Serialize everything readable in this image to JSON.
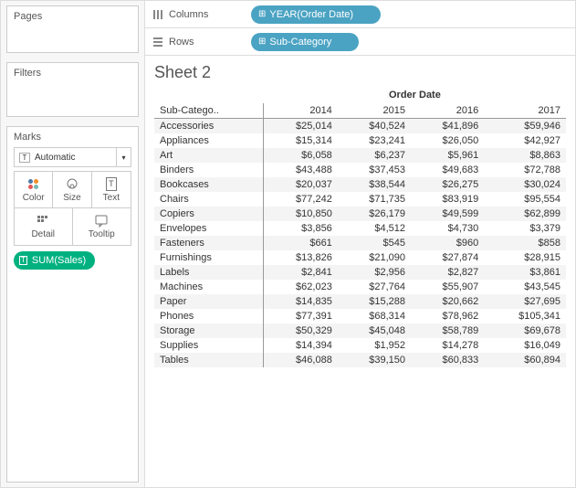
{
  "sidebar": {
    "pages_title": "Pages",
    "filters_title": "Filters",
    "marks_title": "Marks",
    "marks_dropdown": "Automatic",
    "mark_buttons": {
      "color": "Color",
      "size": "Size",
      "text": "Text",
      "detail": "Detail",
      "tooltip": "Tooltip"
    },
    "measure_pill": "SUM(Sales)"
  },
  "shelves": {
    "columns_label": "Columns",
    "columns_pill": "YEAR(Order Date)",
    "rows_label": "Rows",
    "rows_pill": "Sub-Category"
  },
  "sheet": {
    "title": "Sheet 2",
    "super_header": "Order Date",
    "row_header": "Sub-Catego..",
    "columns": [
      "2014",
      "2015",
      "2016",
      "2017"
    ],
    "rows": [
      "Accessories",
      "Appliances",
      "Art",
      "Binders",
      "Bookcases",
      "Chairs",
      "Copiers",
      "Envelopes",
      "Fasteners",
      "Furnishings",
      "Labels",
      "Machines",
      "Paper",
      "Phones",
      "Storage",
      "Supplies",
      "Tables"
    ],
    "values": [
      [
        "$25,014",
        "$40,524",
        "$41,896",
        "$59,946"
      ],
      [
        "$15,314",
        "$23,241",
        "$26,050",
        "$42,927"
      ],
      [
        "$6,058",
        "$6,237",
        "$5,961",
        "$8,863"
      ],
      [
        "$43,488",
        "$37,453",
        "$49,683",
        "$72,788"
      ],
      [
        "$20,037",
        "$38,544",
        "$26,275",
        "$30,024"
      ],
      [
        "$77,242",
        "$71,735",
        "$83,919",
        "$95,554"
      ],
      [
        "$10,850",
        "$26,179",
        "$49,599",
        "$62,899"
      ],
      [
        "$3,856",
        "$4,512",
        "$4,730",
        "$3,379"
      ],
      [
        "$661",
        "$545",
        "$960",
        "$858"
      ],
      [
        "$13,826",
        "$21,090",
        "$27,874",
        "$28,915"
      ],
      [
        "$2,841",
        "$2,956",
        "$2,827",
        "$3,861"
      ],
      [
        "$62,023",
        "$27,764",
        "$55,907",
        "$43,545"
      ],
      [
        "$14,835",
        "$15,288",
        "$20,662",
        "$27,695"
      ],
      [
        "$77,391",
        "$68,314",
        "$78,962",
        "$105,341"
      ],
      [
        "$50,329",
        "$45,048",
        "$58,789",
        "$69,678"
      ],
      [
        "$14,394",
        "$1,952",
        "$14,278",
        "$16,049"
      ],
      [
        "$46,088",
        "$39,150",
        "$60,833",
        "$60,894"
      ]
    ]
  },
  "chart_data": {
    "type": "table",
    "title": "Sheet 2",
    "row_dimension": "Sub-Category",
    "column_dimension": "Order Date (Year)",
    "columns": [
      "2014",
      "2015",
      "2016",
      "2017"
    ],
    "rows": [
      "Accessories",
      "Appliances",
      "Art",
      "Binders",
      "Bookcases",
      "Chairs",
      "Copiers",
      "Envelopes",
      "Fasteners",
      "Furnishings",
      "Labels",
      "Machines",
      "Paper",
      "Phones",
      "Storage",
      "Supplies",
      "Tables"
    ],
    "measure": "SUM(Sales)",
    "values": [
      [
        25014,
        40524,
        41896,
        59946
      ],
      [
        15314,
        23241,
        26050,
        42927
      ],
      [
        6058,
        6237,
        5961,
        8863
      ],
      [
        43488,
        37453,
        49683,
        72788
      ],
      [
        20037,
        38544,
        26275,
        30024
      ],
      [
        77242,
        71735,
        83919,
        95554
      ],
      [
        10850,
        26179,
        49599,
        62899
      ],
      [
        3856,
        4512,
        4730,
        3379
      ],
      [
        661,
        545,
        960,
        858
      ],
      [
        13826,
        21090,
        27874,
        28915
      ],
      [
        2841,
        2956,
        2827,
        3861
      ],
      [
        62023,
        27764,
        55907,
        43545
      ],
      [
        14835,
        15288,
        20662,
        27695
      ],
      [
        77391,
        68314,
        78962,
        105341
      ],
      [
        50329,
        45048,
        58789,
        69678
      ],
      [
        14394,
        1952,
        14278,
        16049
      ],
      [
        46088,
        39150,
        60833,
        60894
      ]
    ]
  }
}
